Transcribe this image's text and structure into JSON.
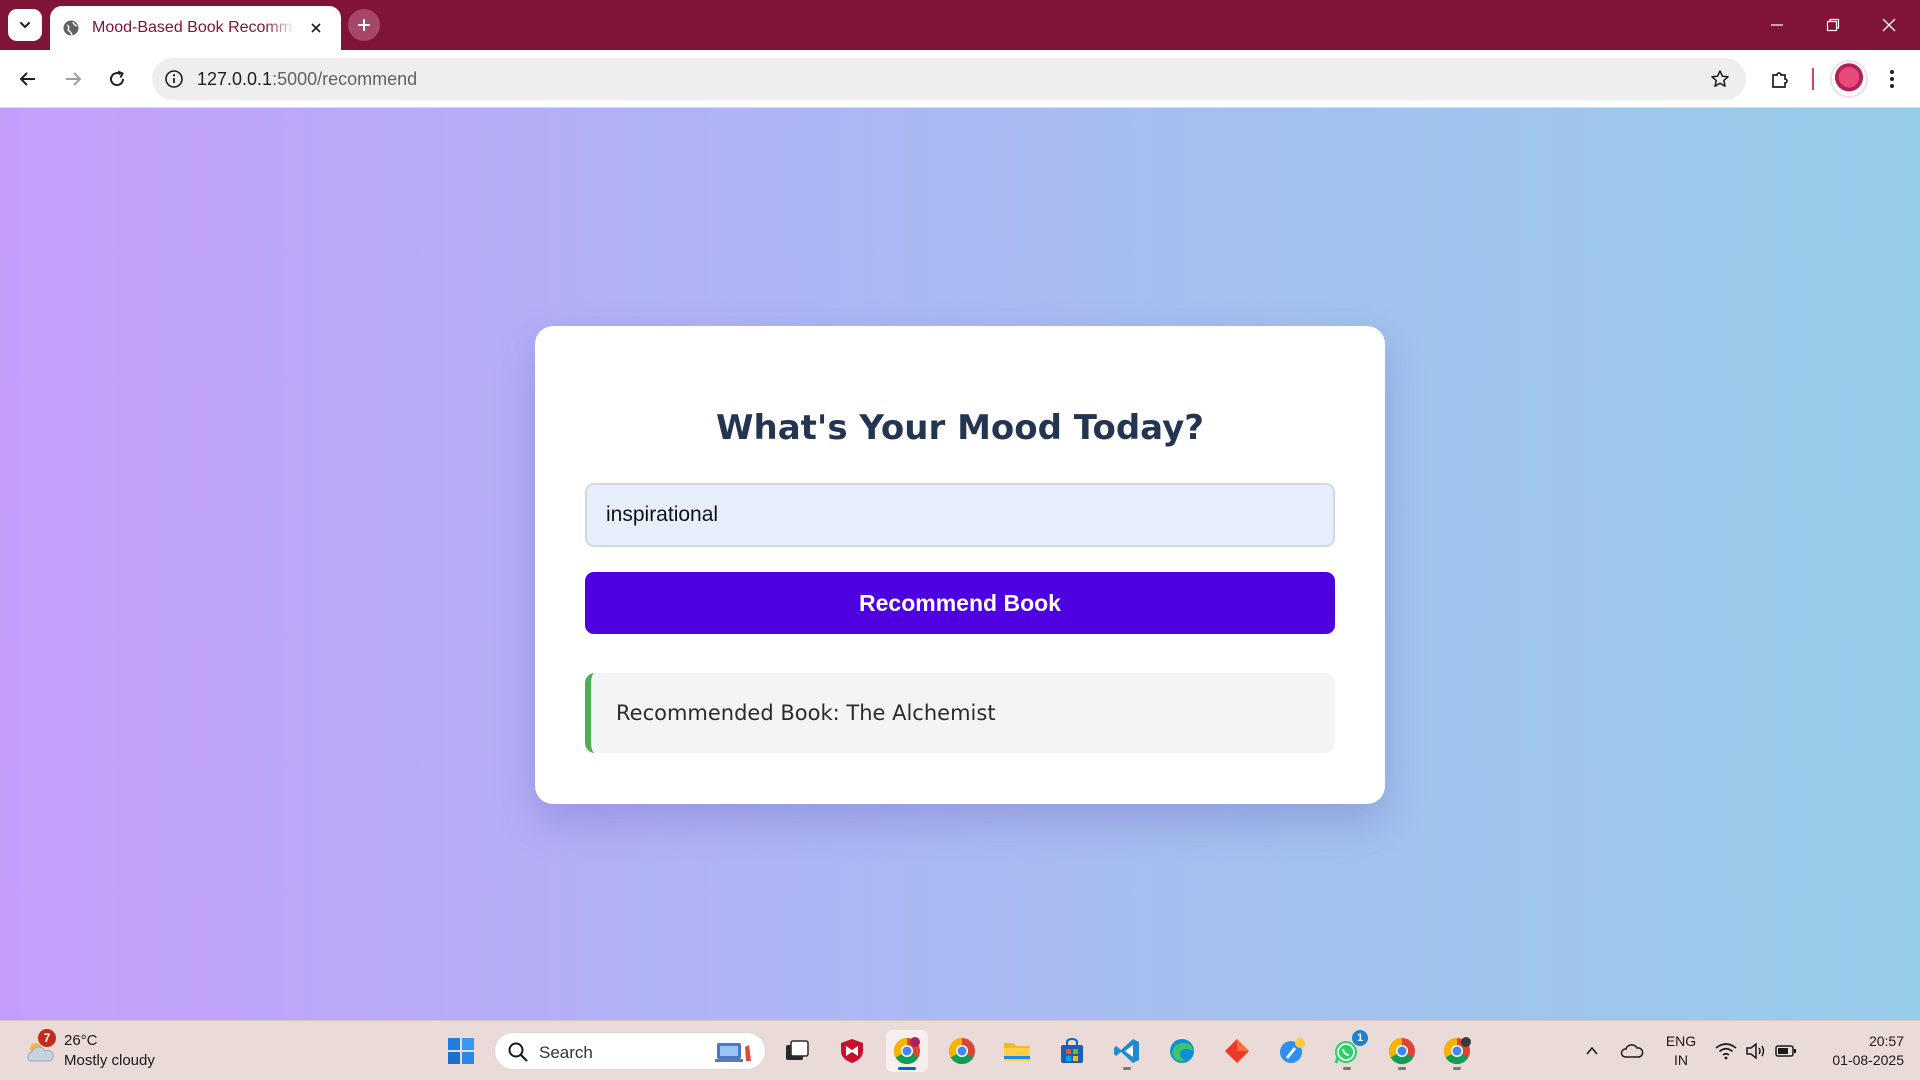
{
  "browser": {
    "tab": {
      "title": "Mood-Based Book Recommender"
    },
    "address": {
      "host": "127.0.0.1",
      "path": ":5000/recommend"
    }
  },
  "page": {
    "heading": "What's Your Mood Today?",
    "mood_input": {
      "value": "inspirational"
    },
    "button_label": "Recommend Book",
    "result_text": "Recommended Book: The Alchemist"
  },
  "taskbar": {
    "weather": {
      "temp": "26°C",
      "condition": "Mostly cloudy",
      "badge": "7"
    },
    "search_label": "Search",
    "whatsapp_badge": "1",
    "language": {
      "line1": "ENG",
      "line2": "IN"
    },
    "clock": {
      "time": "20:57",
      "date": "01-08-2025"
    }
  },
  "colors": {
    "tab_strip": "#801436",
    "primary_button": "#4f00e0",
    "result_accent": "#4caf50",
    "heading": "#243551"
  }
}
